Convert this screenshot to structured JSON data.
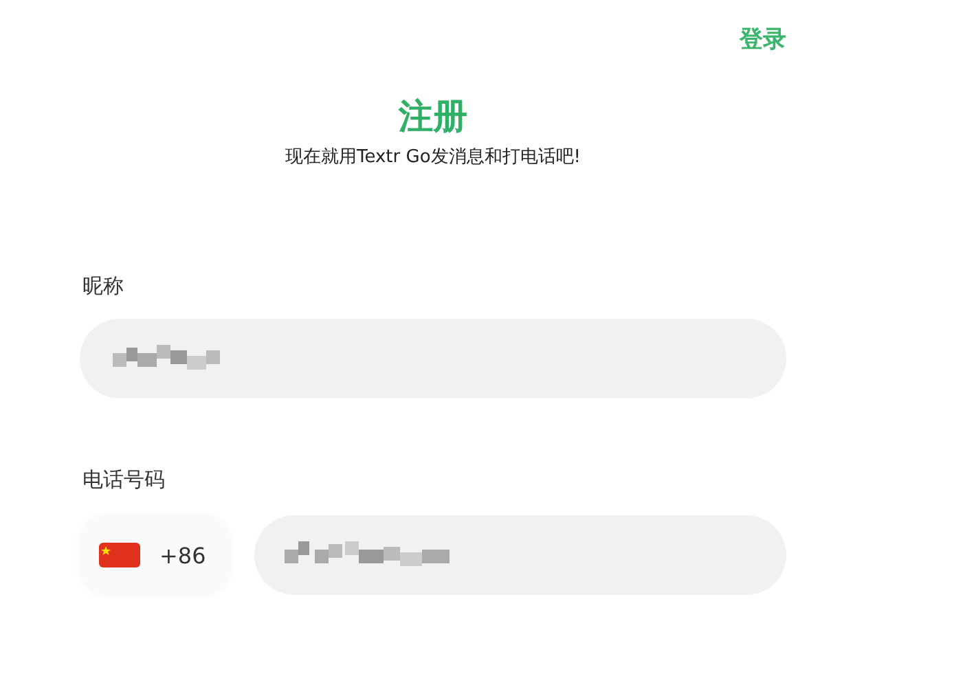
{
  "header": {
    "login_link": "登录"
  },
  "title": "注册",
  "subtitle": "现在就用Textr Go发消息和打电话吧!",
  "nickname": {
    "label": "昵称"
  },
  "phone": {
    "label": "电话号码",
    "country_code": "+86"
  }
}
